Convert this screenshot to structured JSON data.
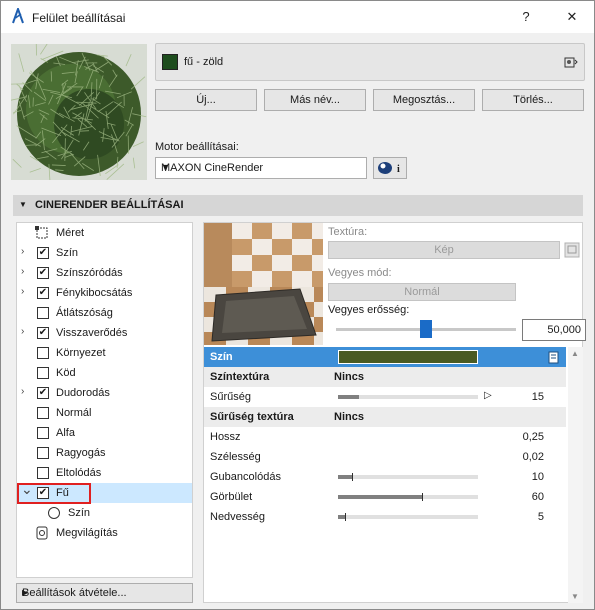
{
  "window": {
    "title": "Felület beállításai",
    "help_label": "?",
    "close_label": "✕"
  },
  "surface": {
    "name": "fű - zöld",
    "swatch_color": "#1e4d1e"
  },
  "buttons": {
    "new": "Új...",
    "rename": "Más név...",
    "share": "Megosztás...",
    "delete": "Törlés..."
  },
  "engine": {
    "label": "Motor beállításai:",
    "selected": "MAXON CineRender",
    "info_icon": "i"
  },
  "section": {
    "title": "CINERENDER BEÁLLÍTÁSAI"
  },
  "tree": {
    "items": [
      {
        "label": "Méret",
        "expandable": false,
        "checkbox": "none",
        "icon": "size-icon"
      },
      {
        "label": "Szín",
        "expandable": true,
        "checkbox": "checked"
      },
      {
        "label": "Színszóródás",
        "expandable": true,
        "checkbox": "checked"
      },
      {
        "label": "Fénykibocsátás",
        "expandable": true,
        "checkbox": "checked"
      },
      {
        "label": "Átlátszóság",
        "expandable": false,
        "checkbox": "unchecked"
      },
      {
        "label": "Visszaverődés",
        "expandable": true,
        "checkbox": "checked"
      },
      {
        "label": "Környezet",
        "expandable": false,
        "checkbox": "unchecked"
      },
      {
        "label": "Köd",
        "expandable": false,
        "checkbox": "unchecked"
      },
      {
        "label": "Dudorodás",
        "expandable": true,
        "checkbox": "checked"
      },
      {
        "label": "Normál",
        "expandable": false,
        "checkbox": "unchecked"
      },
      {
        "label": "Alfa",
        "expandable": false,
        "checkbox": "unchecked"
      },
      {
        "label": "Ragyogás",
        "expandable": false,
        "checkbox": "unchecked"
      },
      {
        "label": "Eltolódás",
        "expandable": false,
        "checkbox": "unchecked"
      },
      {
        "label": "Fű",
        "expandable": true,
        "expanded": true,
        "checkbox": "checked",
        "selected": true
      },
      {
        "label": "Szín",
        "expandable": false,
        "checkbox": "none",
        "icon": "radio-icon",
        "indent": true
      },
      {
        "label": "Megvilágítás",
        "expandable": false,
        "checkbox": "none",
        "icon": "lighting-icon"
      }
    ]
  },
  "transfer": {
    "label": "Beállítások átvétele...",
    "arrow": "▶"
  },
  "texture": {
    "label": "Textúra:",
    "button": "Kép",
    "mix_label": "Vegyes mód:",
    "mix_value": "Normál",
    "strength_label": "Vegyes erősség:",
    "strength_value": "50,000",
    "strength_fraction": 0.5
  },
  "properties": {
    "color_row": {
      "label": "Szín",
      "color": "#4a5a22"
    },
    "rows": [
      {
        "label": "Színtextúra",
        "value": "Nincs",
        "bold": true,
        "shaded": true
      },
      {
        "label": "Sűrűség",
        "number": "15",
        "fill": 0.15,
        "marker": 1.0,
        "arrow": true
      },
      {
        "label": "Sűrűség textúra",
        "value": "Nincs",
        "bold": true,
        "shaded": true
      },
      {
        "label": "Hossz",
        "number": "0,25"
      },
      {
        "label": "Szélesség",
        "number": "0,02"
      },
      {
        "label": "Gubancolódás",
        "number": "10",
        "fill": 0.1
      },
      {
        "label": "Görbület",
        "number": "60",
        "fill": 0.6
      },
      {
        "label": "Nedvesség",
        "number": "5",
        "fill": 0.05
      }
    ]
  }
}
